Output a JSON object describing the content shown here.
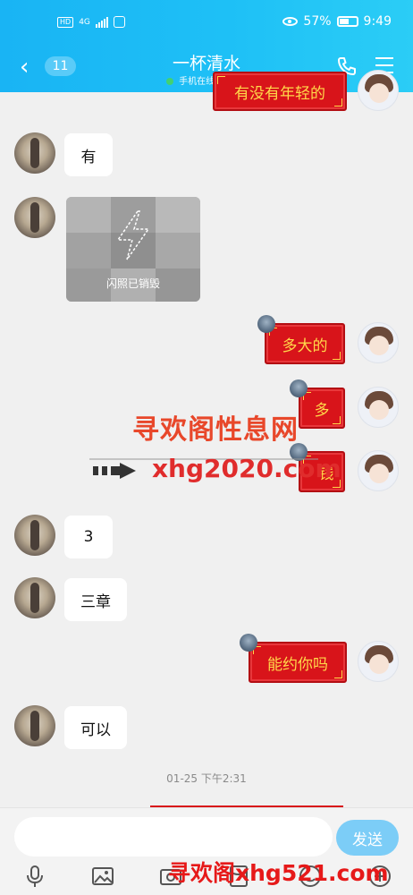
{
  "status": {
    "network": "4G",
    "battery": "57%",
    "time": "9:49"
  },
  "header": {
    "unread_count": "11",
    "contact_name": "一杯清水",
    "online_status": "手机在线 - 4G >"
  },
  "messages": [
    {
      "sender": "me",
      "text": "有没有年轻的",
      "style": "red-card"
    },
    {
      "sender": "friend",
      "text": "有"
    },
    {
      "sender": "friend",
      "type": "photo",
      "text": "闪照已销毁"
    },
    {
      "sender": "me",
      "text": "多大的",
      "style": "red-card"
    },
    {
      "sender": "me",
      "text": "多",
      "style": "red-card"
    },
    {
      "sender": "me",
      "text": "钱",
      "style": "red-card"
    },
    {
      "sender": "friend",
      "text": "3"
    },
    {
      "sender": "friend",
      "text": "三章"
    },
    {
      "sender": "me",
      "text": "能约你吗",
      "style": "red-card"
    },
    {
      "sender": "friend",
      "text": "可以"
    }
  ],
  "timestamp": "01-25 下午2:31",
  "watermark": {
    "title": "寻欢阁性息网",
    "url": "xhg2020.com",
    "bottom": "寻欢阁xhg521.com"
  },
  "input": {
    "placeholder": "",
    "send_label": "发送"
  },
  "icons": [
    "back-icon",
    "phone-icon",
    "menu-icon",
    "microphone-icon",
    "image-icon",
    "camera-icon",
    "red-packet-icon",
    "emoji-icon",
    "plus-icon"
  ],
  "colors": {
    "header": "#1ec0f6",
    "red_card": "#d8141a",
    "send": "#7ccdf7"
  }
}
